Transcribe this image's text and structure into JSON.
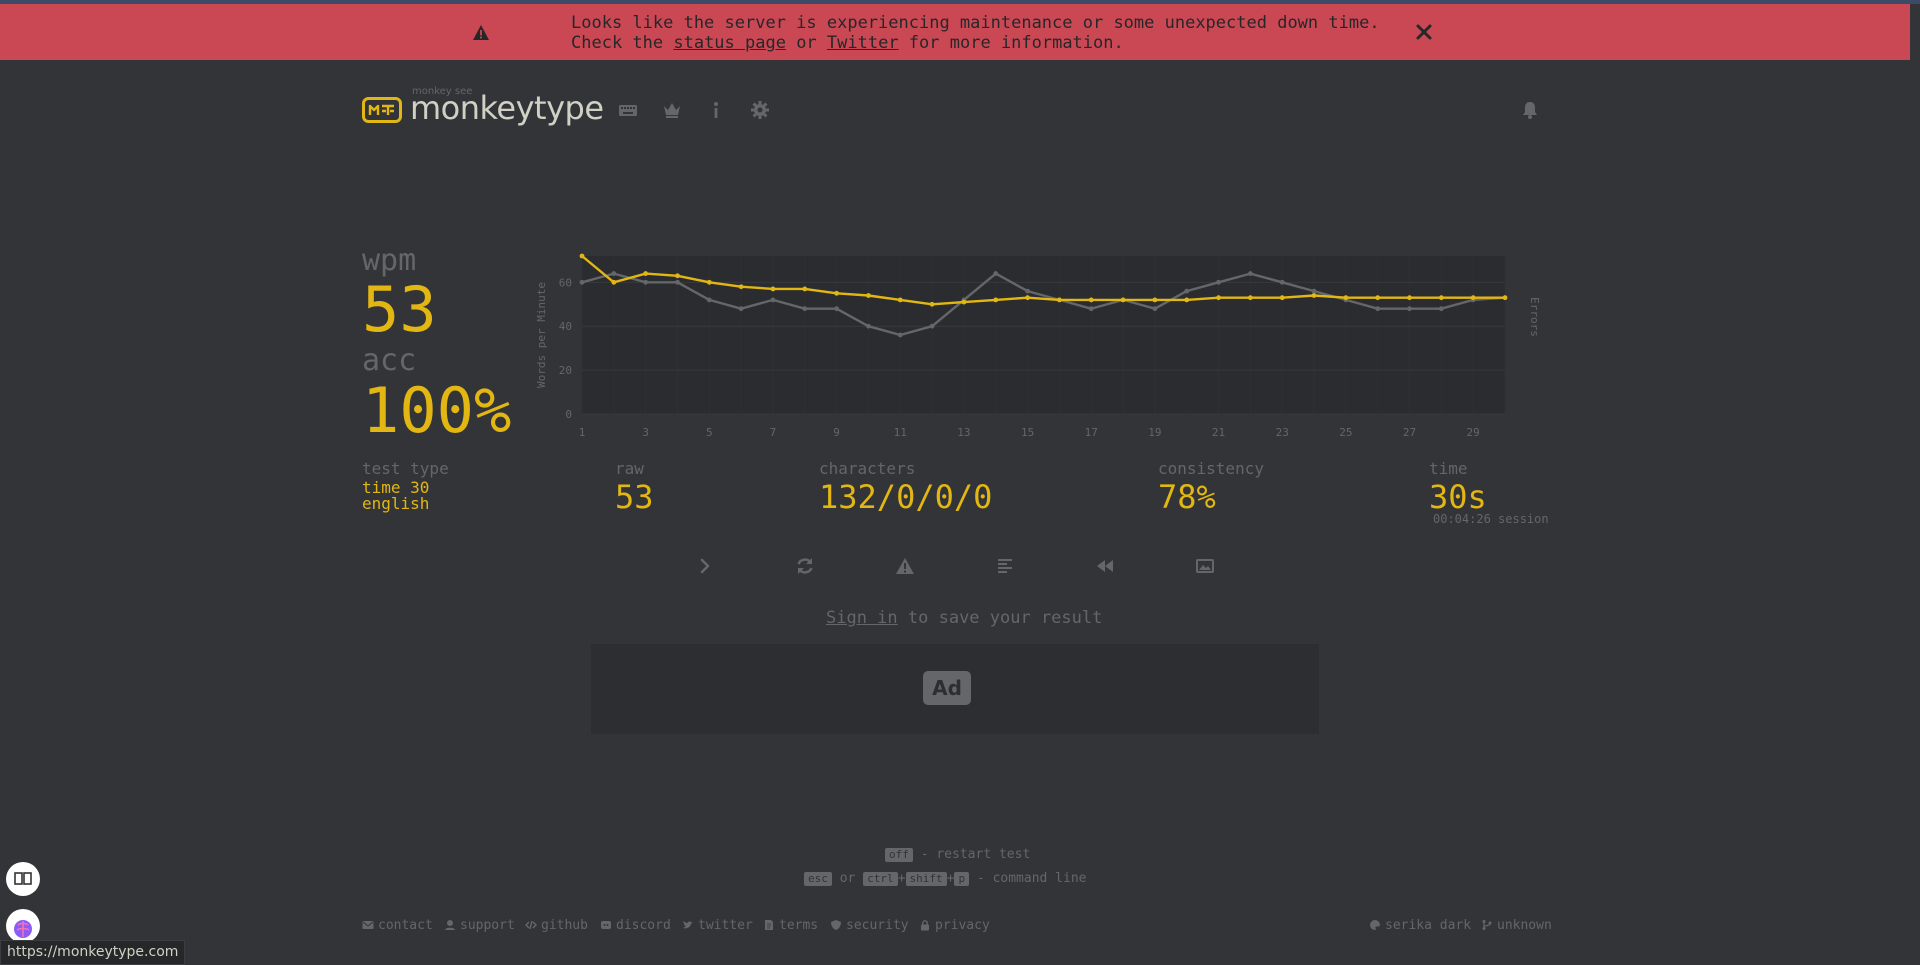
{
  "banner": {
    "line1": "Looks like the server is experiencing maintenance or some unexpected down time.",
    "line2_prefix": "Check the ",
    "status_link": "status page",
    "line2_mid": " or ",
    "twitter_link": "Twitter",
    "line2_suffix": " for more information."
  },
  "header": {
    "logo_top": "monkey see",
    "logo_text": "monkeytype",
    "nav_icons": [
      "keyboard-icon",
      "crown-icon",
      "info-icon",
      "gear-icon"
    ],
    "right_icon": "bell-icon"
  },
  "result": {
    "wpm_label": "wpm",
    "wpm_value": "53",
    "acc_label": "acc",
    "acc_value": "100%",
    "test_type_label": "test type",
    "test_type_line1": "time 30",
    "test_type_line2": "english",
    "raw_label": "raw",
    "raw_value": "53",
    "characters_label": "characters",
    "characters_value": "132/0/0/0",
    "consistency_label": "consistency",
    "consistency_value": "78%",
    "time_label": "time",
    "time_value": "30s",
    "session_text": "00:04:26 session"
  },
  "chart_data": {
    "type": "line",
    "ylabel": "Words per Minute",
    "y2label": "Errors",
    "ylim": [
      0,
      72
    ],
    "yticks": [
      0,
      20,
      40,
      60
    ],
    "x": [
      1,
      2,
      3,
      4,
      5,
      6,
      7,
      8,
      9,
      10,
      11,
      12,
      13,
      14,
      15,
      16,
      17,
      18,
      19,
      20,
      21,
      22,
      23,
      24,
      25,
      26,
      27,
      28,
      29,
      30
    ],
    "xticks": [
      1,
      3,
      5,
      7,
      9,
      11,
      13,
      15,
      17,
      19,
      21,
      23,
      25,
      27,
      29
    ],
    "series": [
      {
        "key": "wpm",
        "color": "#e2b714",
        "values": [
          72,
          60,
          64,
          63,
          60,
          58,
          57,
          57,
          55,
          54,
          52,
          50,
          51,
          52,
          53,
          52,
          52,
          52,
          52,
          52,
          53,
          53,
          53,
          54,
          53,
          53,
          53,
          53,
          53,
          53
        ]
      },
      {
        "key": "raw",
        "color": "#646669",
        "values": [
          60,
          64,
          60,
          60,
          52,
          48,
          52,
          48,
          48,
          40,
          36,
          40,
          52,
          64,
          56,
          52,
          48,
          52,
          48,
          56,
          60,
          64,
          60,
          56,
          52,
          48,
          48,
          48,
          52,
          53
        ]
      }
    ],
    "grid": true
  },
  "actions": [
    "next-test-icon",
    "restart-icon",
    "report-icon",
    "word-history-icon",
    "replay-icon",
    "screenshot-icon"
  ],
  "signin": {
    "link": "Sign in",
    "rest": " to save your result"
  },
  "ad": {
    "label": "Ad"
  },
  "hints": {
    "key_off": "off",
    "restart_text": " - restart test",
    "key_esc": "esc",
    "or_text": " or ",
    "key_ctrl": "ctrl",
    "plus": "+",
    "key_shift": "shift",
    "key_p": "p",
    "command_text": " - command line"
  },
  "footer": {
    "contact": "contact",
    "support": "support",
    "github": "github",
    "discord": "discord",
    "twitter": "twitter",
    "terms": "terms",
    "security": "security",
    "privacy": "privacy",
    "theme": "serika dark",
    "version": "unknown"
  },
  "status_url": "https://monkeytype.com"
}
